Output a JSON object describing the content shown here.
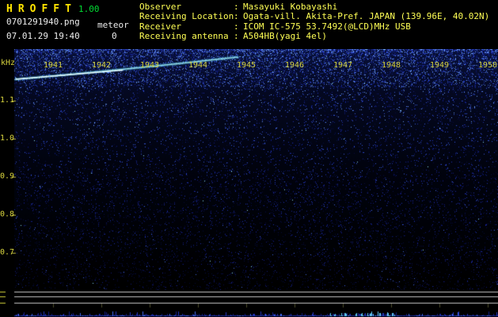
{
  "app": {
    "name": "HROFFT",
    "version": "1.00"
  },
  "capture": {
    "filename": "0701291940.png",
    "counter_label": "meteor",
    "counter_value": "0",
    "datetime": "07.01.29 19:40"
  },
  "station": {
    "separator": ":",
    "rows": [
      {
        "label": "Observer",
        "value": "Masayuki Kobayashi"
      },
      {
        "label": "Receiving Location",
        "value": "Ogata-vill. Akita-Pref. JAPAN (139.96E, 40.02N)"
      },
      {
        "label": "Receiver",
        "value": "ICOM IC-575 53.7492(@LCD)MHz USB"
      },
      {
        "label": "Receiving antenna",
        "value": "A504HB(yagi 4el)"
      }
    ]
  },
  "spectrogram": {
    "y_axis_unit": "kHz",
    "time_labels": [
      "1941",
      "1942",
      "1943",
      "1944",
      "1945",
      "1946",
      "1947",
      "1948",
      "1949",
      "1950"
    ],
    "freq_labels": [
      "1.1",
      "1.0",
      "0.9",
      "0.8",
      "0.7"
    ],
    "colors": {
      "axis_label": "#d6d23e",
      "noise_blue": "#2436cc",
      "meteor_trace": "#aef6ff",
      "header_text": "#ffff55",
      "title": "#ffe400",
      "version": "#00dd33"
    }
  }
}
